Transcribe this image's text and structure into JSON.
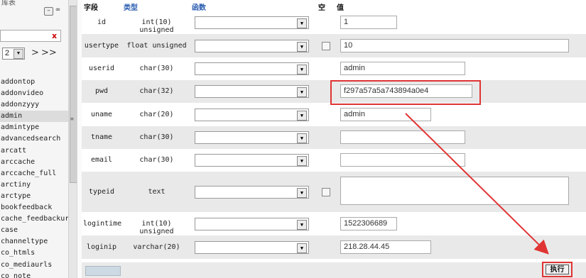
{
  "sidebar": {
    "top_text": "库表",
    "collapse_icon": "minus-icon",
    "link_icon": "link-icon",
    "filter_clear": "x",
    "page": "2",
    "next": ">",
    "last": ">>",
    "tables": [
      "addontop",
      "addonvideo",
      "addonzyyy",
      "admin",
      "admintype",
      "advancedsearch",
      "arcatt",
      "arccache",
      "arccache_full",
      "arctiny",
      "arctype",
      "bookfeedback",
      "cache_feedbackurl",
      "case",
      "channeltype",
      "co_htmls",
      "co_mediaurls",
      "co_note"
    ],
    "active_index": 3
  },
  "columns": {
    "field": "字段",
    "type": "类型",
    "function": "函数",
    "null": "空",
    "value": "值"
  },
  "rows": [
    {
      "field": "id",
      "type": "int(10) unsigned",
      "value": "1",
      "has_null": false
    },
    {
      "field": "usertype",
      "type": "float unsigned",
      "value": "10",
      "has_null": true
    },
    {
      "field": "userid",
      "type": "char(30)",
      "value": "admin",
      "has_null": false
    },
    {
      "field": "pwd",
      "type": "char(32)",
      "value": "f297a57a5a743894a0e4",
      "has_null": false
    },
    {
      "field": "uname",
      "type": "char(20)",
      "value": "admin",
      "has_null": false
    },
    {
      "field": "tname",
      "type": "char(30)",
      "value": "",
      "has_null": false
    },
    {
      "field": "email",
      "type": "char(30)",
      "value": "",
      "has_null": false
    },
    {
      "field": "typeid",
      "type": "text",
      "value": "",
      "has_null": true
    },
    {
      "field": "logintime",
      "type": "int(10) unsigned",
      "value": "1522306689",
      "has_null": false
    },
    {
      "field": "loginip",
      "type": "varchar(20)",
      "value": "218.28.44.45",
      "has_null": false
    }
  ],
  "execute_label": "执行",
  "colors": {
    "highlight": "#e03434",
    "header_link": "#2a5db0",
    "row_alt": "#e9e9e9"
  }
}
